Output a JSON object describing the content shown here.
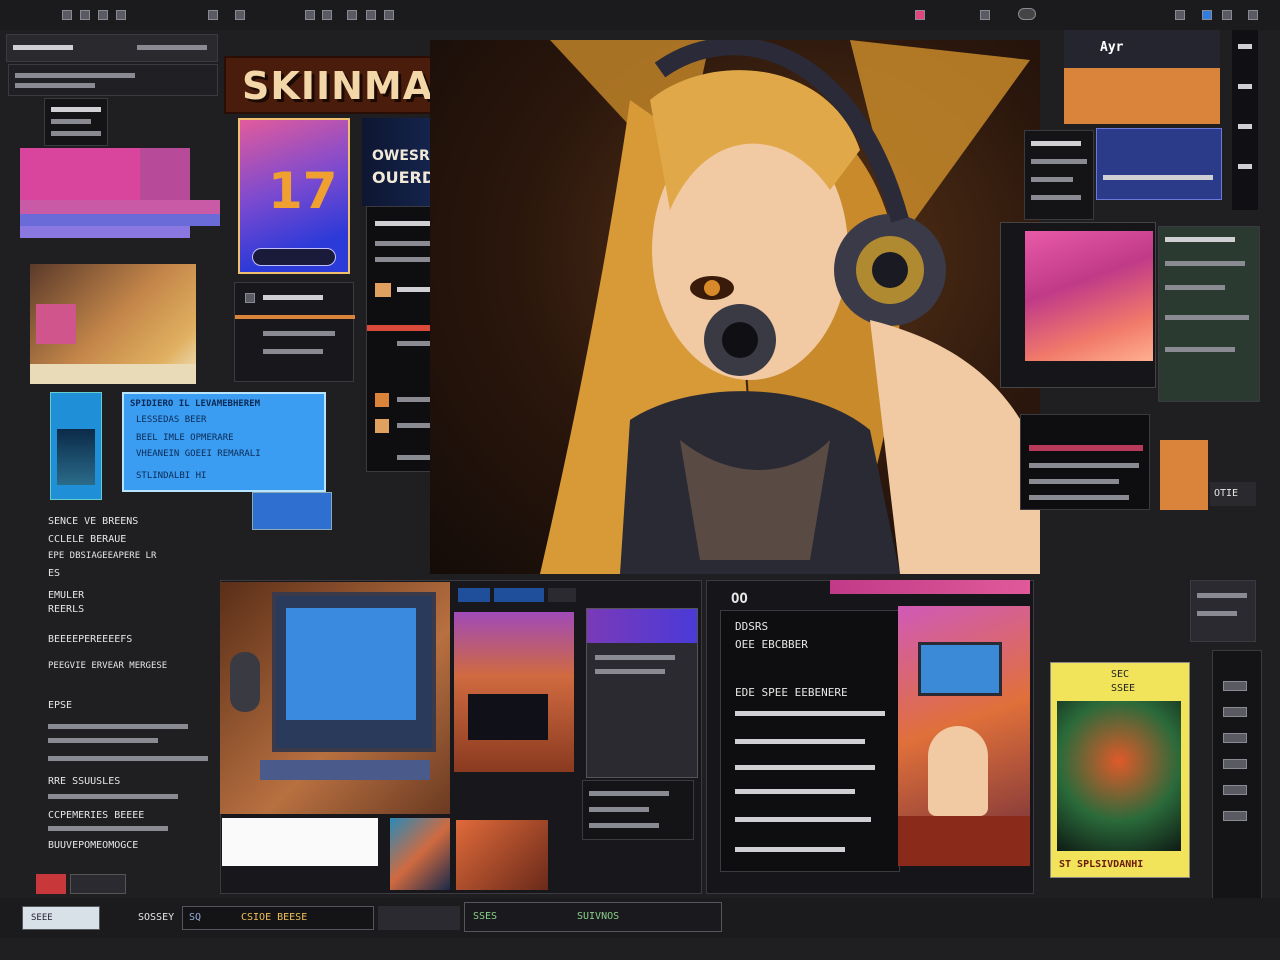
{
  "header": {
    "logo_text": "SKIINMARS",
    "right_label": "Ayr"
  },
  "promo": {
    "glyph": "17",
    "headline1": "OWESROUF HRE",
    "headline2": "OUERDSUUI IREC"
  },
  "blue_dialog": {
    "title": "SPIDIERO IL LEVAMEBHEREM",
    "line1": "LESSEDAS BEER",
    "line2": "BEEL IMLE OPMERARE",
    "line3": "VHEANEIN GOEEI REMARALI",
    "line4": "STLINDALBI HI"
  },
  "left_text": {
    "l1": "SENCE  VE BREENS",
    "l2": "CCLELE BERAUE",
    "l3": "EPE DBSIAGEEAPERE LR",
    "l4": "ES",
    "l5": "EMULER",
    "l6": "REERLS",
    "l7": "BEEEEPEREEEEFS",
    "l8": "PEEGVIE ERVEAR MERGESE",
    "l9": "EPSE",
    "l10": "RRE SSUUSLES",
    "l11": "CCPEMERIES BEEEE",
    "l12": "BUUVEPOMEOMOGCE"
  },
  "chat_panel": {
    "header": "OO",
    "line1": "DDSRS",
    "line2": "OEE EBCBBER",
    "line3": "EDE SPEE EEBENERE"
  },
  "poster": {
    "top1": "SEC",
    "top2": "SSEE",
    "bottom": "ST SPLSIVDANHI"
  },
  "bottom_bar": {
    "b1": "SEEE",
    "b2": "SQ",
    "b3": "CSIOE BEESE",
    "b4": "SSES",
    "b5": "SUIVNOS",
    "b6": "SOSSEY"
  },
  "tag_right": "OTIE",
  "colors": {
    "accent_pink": "#e0457b",
    "accent_blue": "#2f7de0",
    "accent_orange": "#d9843a",
    "poster_yellow": "#f1e35a"
  }
}
